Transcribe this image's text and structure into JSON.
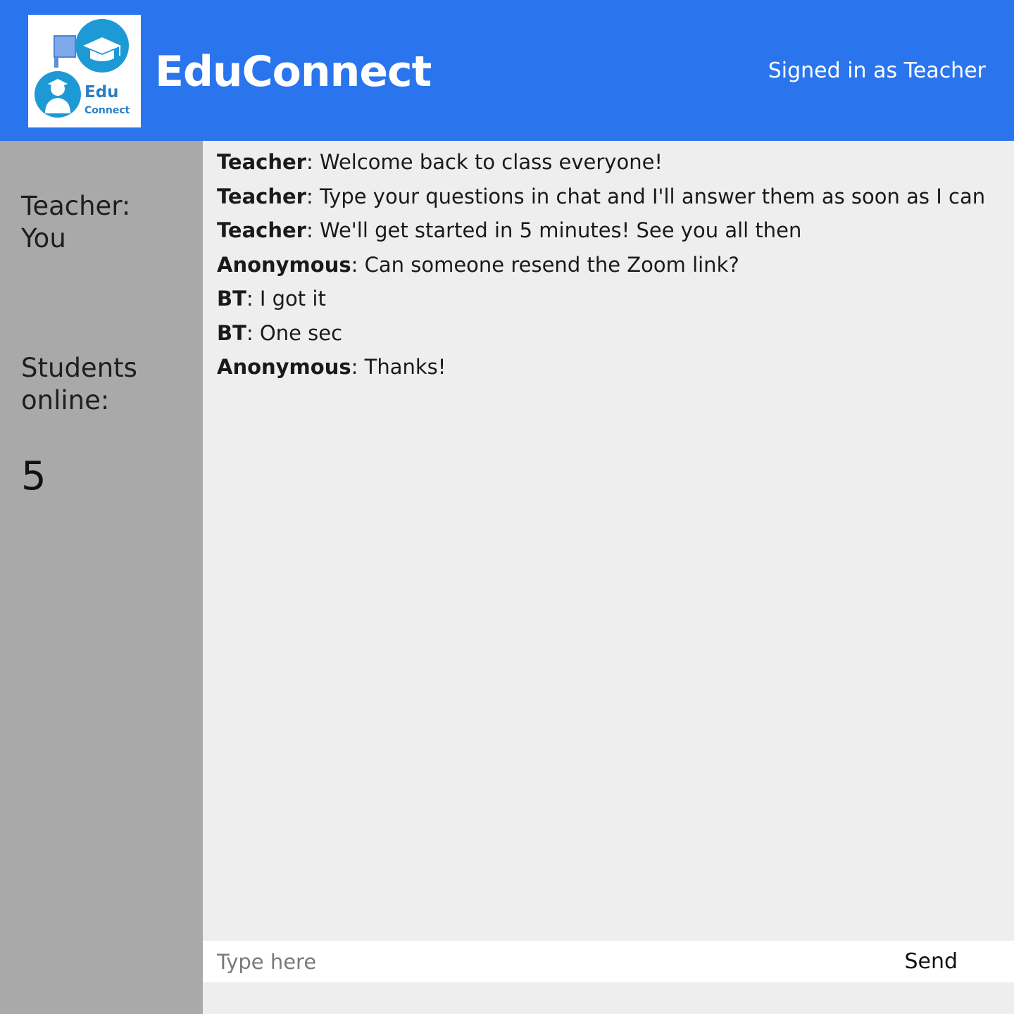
{
  "header": {
    "logo": {
      "text_primary": "Edu",
      "text_secondary": "Connect",
      "icons": [
        "flag-icon",
        "graduation-cap-icon",
        "student-avatar-icon"
      ]
    },
    "title": "EduConnect",
    "signed_in_text": "Signed in as Teacher"
  },
  "sidebar": {
    "teacher_label": "Teacher:",
    "teacher_value": "You",
    "students_label_line1": "Students",
    "students_label_line2": "online:",
    "students_count": "5"
  },
  "chat": {
    "messages": [
      {
        "sender": "Teacher",
        "text": ": Welcome back to class everyone!"
      },
      {
        "sender": "Teacher",
        "text": ": Type your questions in chat and I'll answer them as soon as I can"
      },
      {
        "sender": "Teacher",
        "text": ": We'll get started in 5 minutes! See you all then"
      },
      {
        "sender": "Anonymous",
        "text": ": Can someone resend the Zoom link?"
      },
      {
        "sender": "BT",
        "text": ": I got it"
      },
      {
        "sender": "BT",
        "text": ": One sec"
      },
      {
        "sender": "Anonymous",
        "text": ": Thanks!"
      }
    ]
  },
  "composer": {
    "placeholder": "Type here",
    "value": "",
    "send_label": "Send"
  },
  "colors": {
    "header_bg": "#2a75ee",
    "sidebar_bg": "#a9a9a9",
    "chat_bg": "#eeeeee",
    "logo_blue": "#1d9ad6",
    "logo_text": "#2b7fc4"
  }
}
